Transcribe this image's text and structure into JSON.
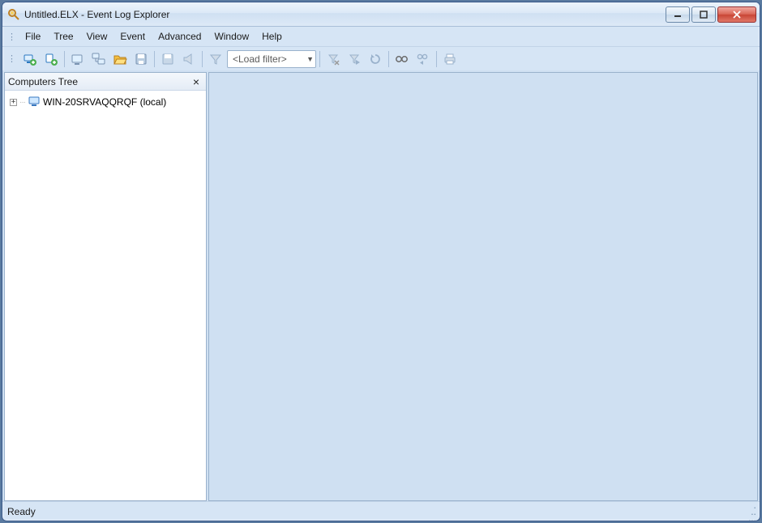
{
  "window": {
    "title": "Untitled.ELX - Event Log Explorer"
  },
  "menu": {
    "items": [
      "File",
      "Tree",
      "View",
      "Event",
      "Advanced",
      "Window",
      "Help"
    ]
  },
  "toolbar": {
    "filter_placeholder": "<Load filter>"
  },
  "tree_panel": {
    "title": "Computers Tree",
    "nodes": [
      {
        "label": "WIN-20SRVAQQRQF (local)",
        "expandable": true
      }
    ]
  },
  "status": {
    "text": "Ready"
  }
}
